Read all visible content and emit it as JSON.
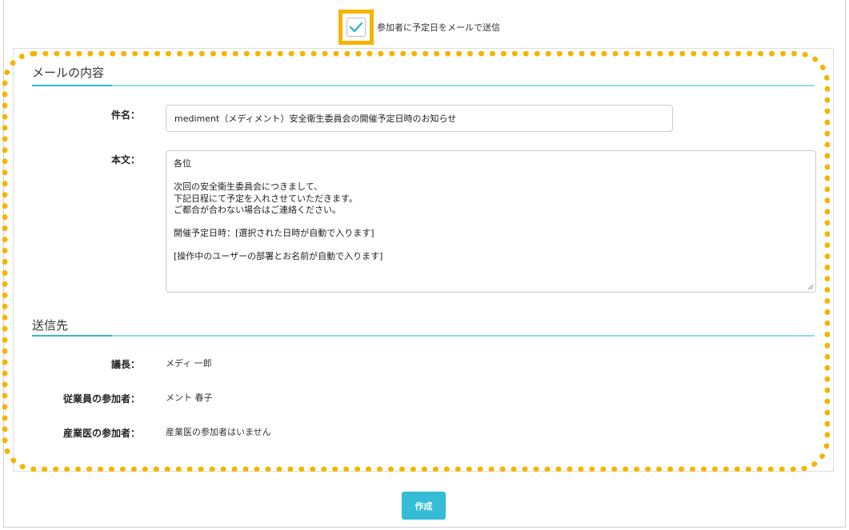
{
  "notify": {
    "checked": true,
    "label": "参加者に予定日をメールで送信"
  },
  "mail": {
    "section_title": "メールの内容",
    "subject_label": "件名：",
    "subject_value": "mediment（メディメント）安全衛生委員会の開催予定日時のお知らせ",
    "body_label": "本文：",
    "body_lines": [
      "各位",
      "",
      "次回の安全衛生委員会につきまして、",
      "下記日程にて予定を入れさせていただきます。",
      "ご都合が合わない場合はご連絡ください。",
      "",
      "開催予定日時：[選択された日時が自動で入ります]",
      "",
      "[操作中のユーザーの部署とお名前が自動で入ります]"
    ]
  },
  "recipients": {
    "section_title": "送信先",
    "chair_label": "議長：",
    "chair_value": "メディ 一郎",
    "employee_label": "従業員の参加者：",
    "employee_value": "メント 春子",
    "doctor_label": "産業医の参加者：",
    "doctor_value": "産業医の参加者はいません"
  },
  "actions": {
    "create_label": "作成"
  },
  "colors": {
    "accent": "#35bcd6",
    "highlight": "#f5b400",
    "check": "#35b6d6"
  },
  "icons": {
    "checkbox": "checkmark-icon",
    "resize": "resize-grip-icon"
  }
}
